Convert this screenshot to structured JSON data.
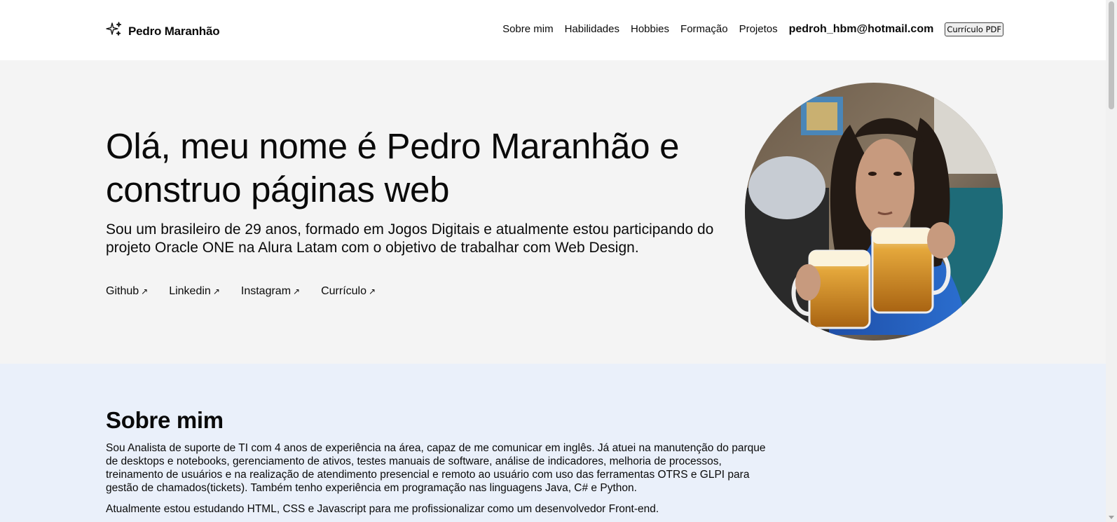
{
  "header": {
    "brand_name": "Pedro Maranhão",
    "brand_icon": "sparkles-icon",
    "nav": [
      "Sobre mim",
      "Habilidades",
      "Hobbies",
      "Formação",
      "Projetos"
    ],
    "email": "pedroh_hbm@hotmail.com",
    "cv_button": "Currículo PDF"
  },
  "hero": {
    "title": "Olá, meu nome é Pedro Maranhão e construo páginas web",
    "description": "Sou um brasileiro de 29 anos, formado em Jogos Digitais e atualmente estou participando do projeto Oracle ONE na Alura Latam com o objetivo de trabalhar com Web Design.",
    "links": [
      "Github",
      "Linkedin",
      "Instagram",
      "Currículo"
    ],
    "link_icon": "arrow-up-right-icon"
  },
  "about": {
    "heading": "Sobre mim",
    "paragraph1": "Sou Analista de suporte de TI com 4 anos de experiência na área, capaz de me comunicar em inglês. Já atuei na manutenção do parque de desktops e notebooks, gerenciamento de ativos, testes manuais de software, análise de indicadores, melhoria de processos, treinamento de usuários e na realização de atendimento presencial e remoto ao usuário com uso das ferramentas OTRS e GLPI para gestão de chamados(tickets). Também tenho experiência em programação nas linguagens Java, C# e Python.",
    "paragraph2": "Atualmente estou estudando HTML, CSS e Javascript para me profissionalizar como um desenvolvedor Front-end."
  },
  "colors": {
    "hero_bg": "#f4f4f4",
    "about_bg": "#eaf0fa",
    "text": "#0a0a0a"
  }
}
